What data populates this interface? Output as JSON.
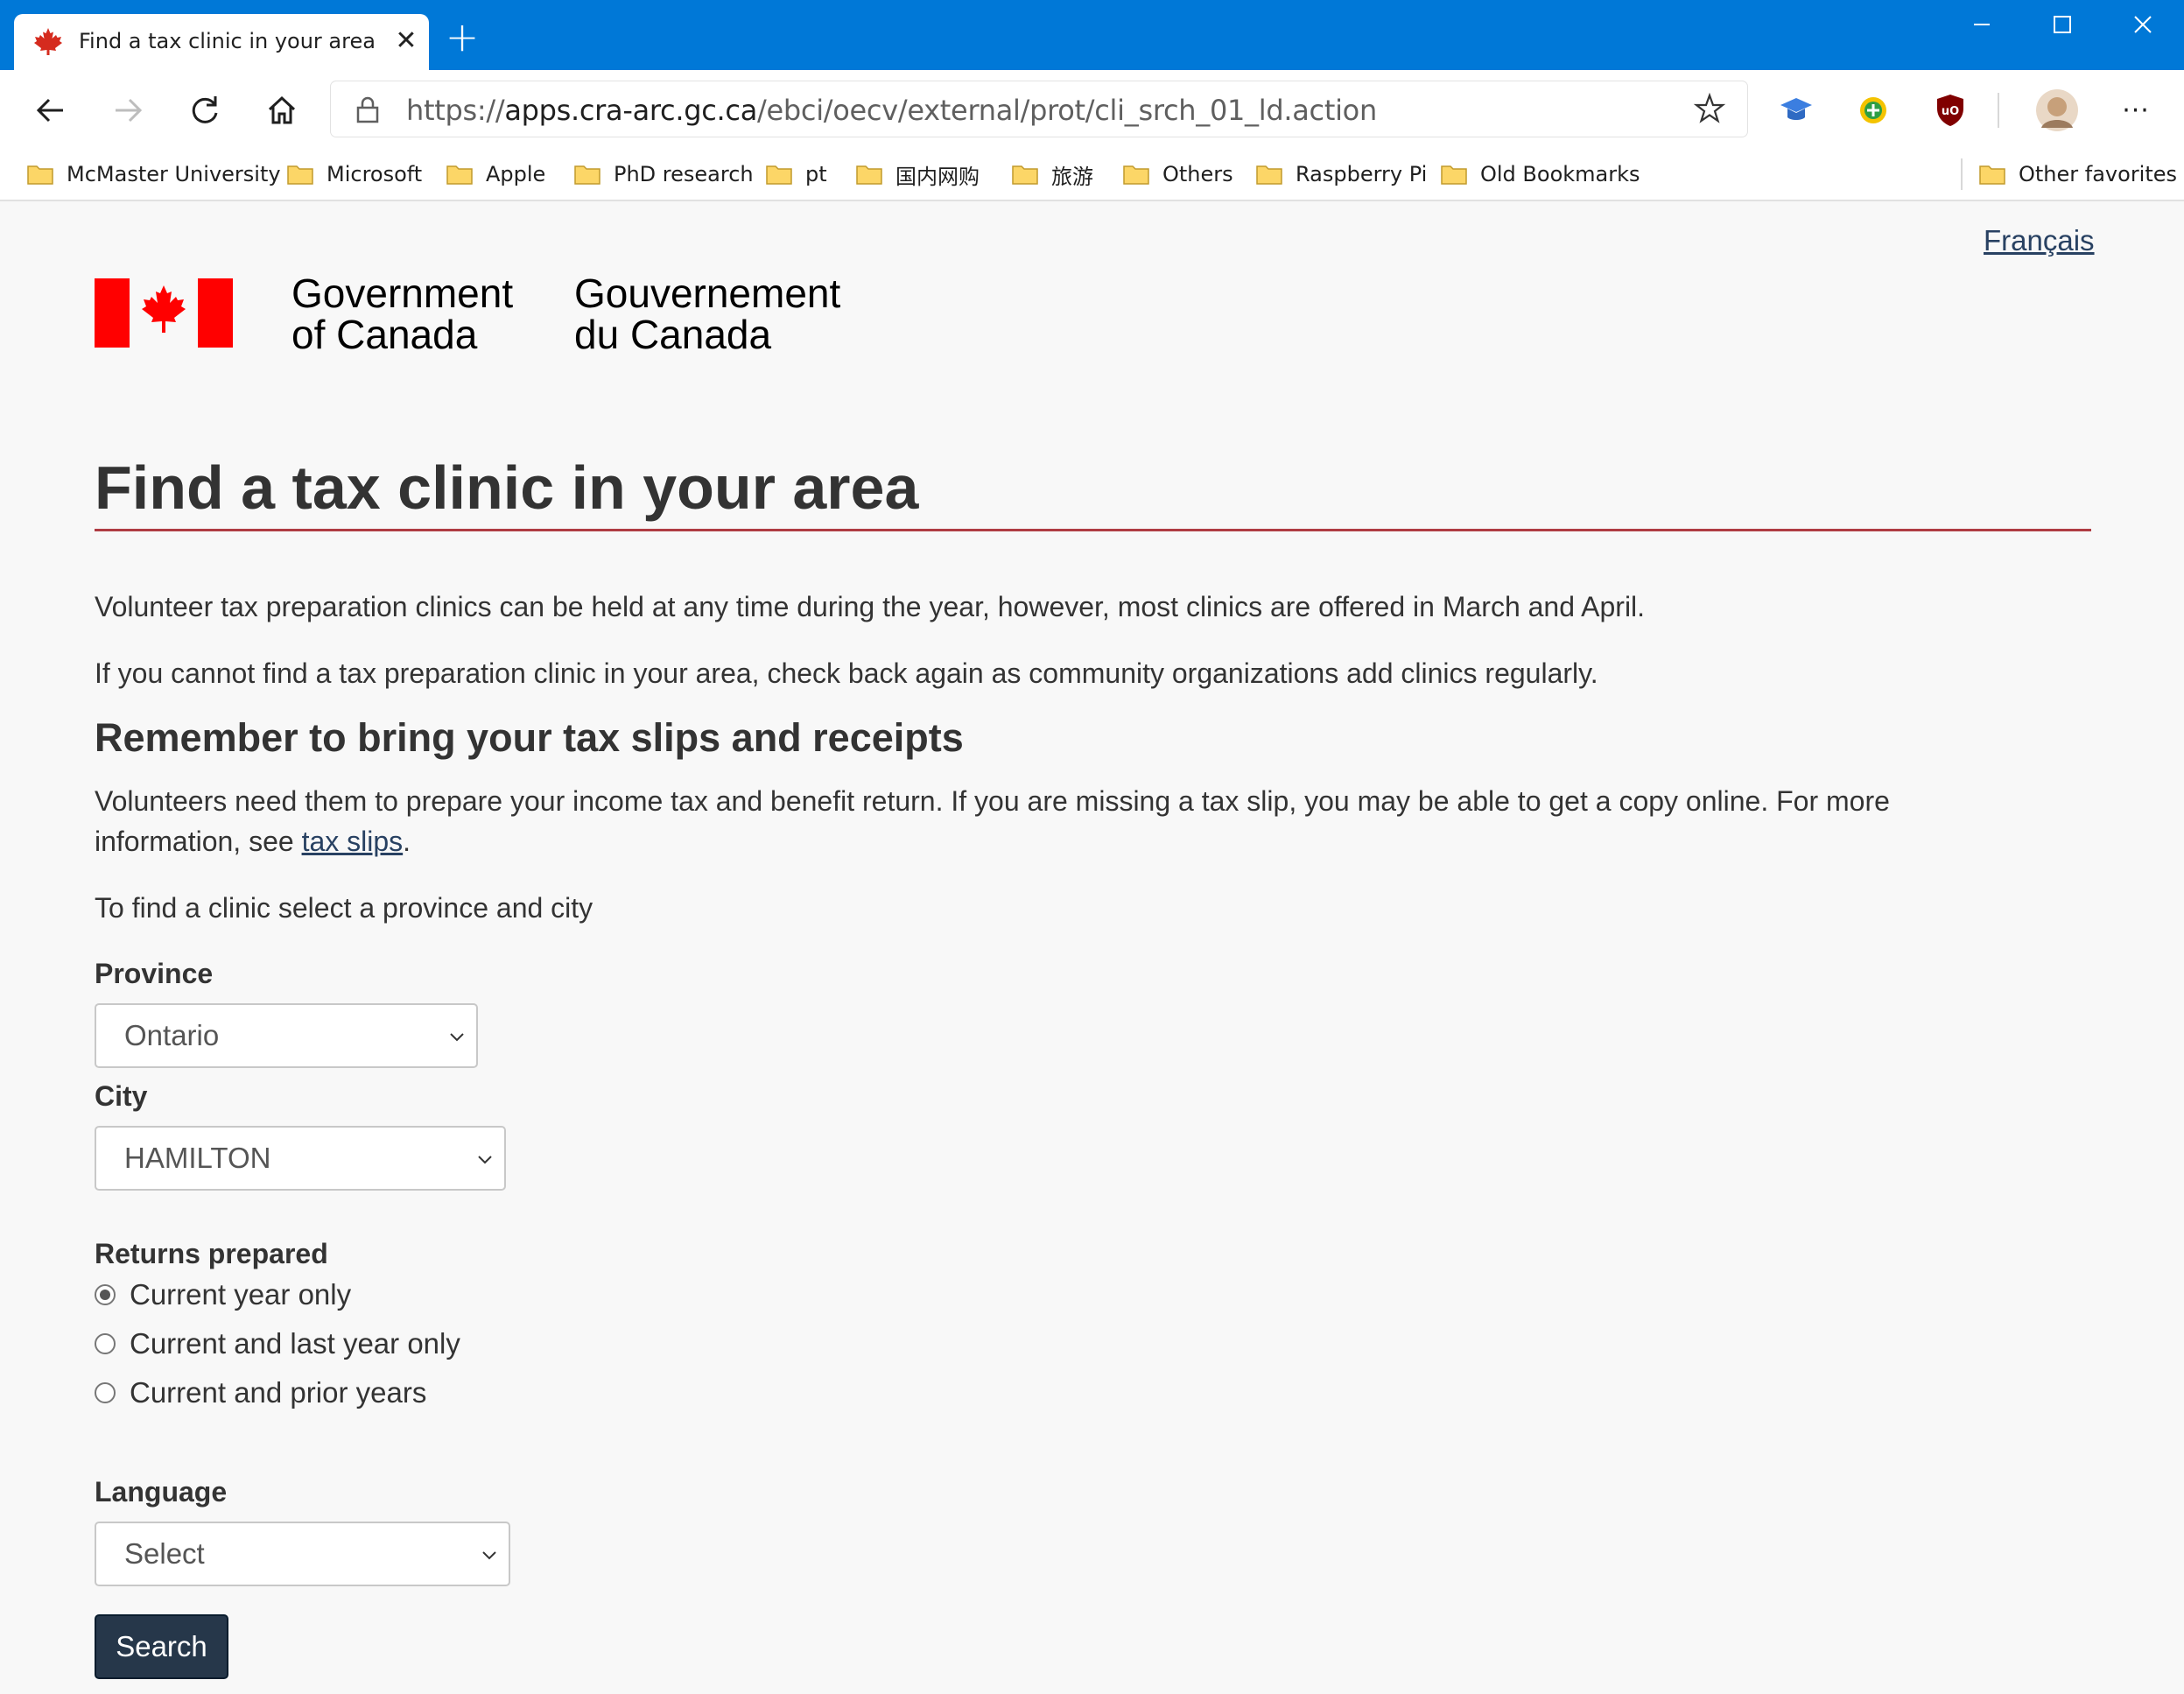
{
  "browser": {
    "tab_title": "Find a tax clinic in your area",
    "tab_close_glyph": "✕",
    "new_tab_glyph": "+",
    "window_buttons": {
      "minimize": "—",
      "maximize": "☐",
      "close": "✕"
    },
    "url_scheme": "https://",
    "url_host": "apps.cra-arc.gc.ca",
    "url_path": "/ebci/oecv/external/prot/cli_srch_01_ld.action",
    "more_glyph": "···",
    "bookmarks": [
      "McMaster University",
      "Microsoft",
      "Apple",
      "PhD research",
      "pt",
      "国内网购",
      "旅游",
      "Others",
      "Raspberry Pi",
      "Old Bookmarks"
    ],
    "other_favorites": "Other favorites",
    "icons": [
      "back-icon",
      "forward-icon",
      "refresh-icon",
      "home-icon",
      "lock-icon",
      "favorite-star-icon",
      "folder-icon"
    ],
    "colors": {
      "titlebar": "#0078d7",
      "cra_blue": "#26374a",
      "canada_red": "#ff0000",
      "rule_red": "#af3c43",
      "link": "#284162"
    }
  },
  "page": {
    "language_toggle": "Français",
    "gov_en_line1": "Government",
    "gov_en_line2": "of Canada",
    "gov_fr_line1": "Gouvernement",
    "gov_fr_line2": "du Canada",
    "title": "Find a tax clinic in your area",
    "intro_1": "Volunteer tax preparation clinics can be held at any time during the year, however, most clinics are offered in March and April.",
    "intro_2": "If you cannot find a tax preparation clinic in your area, check back again as community organizations add clinics regularly.",
    "heading_2": "Remember to bring your tax slips and receipts",
    "slips_line1": "Volunteers need them to prepare your income tax and benefit return. If you are missing a tax slip, you may be able to get a copy online. For more",
    "slips_line2_prefix": "information, see ",
    "slips_link": "tax slips",
    "slips_line2_suffix": ".",
    "instruction": "To find a clinic select a province and city",
    "province_label": "Province",
    "province_value": "Ontario",
    "city_label": "City",
    "city_value": "HAMILTON",
    "returns_label": "Returns prepared",
    "returns_options": [
      {
        "label": "Current year only",
        "selected": true
      },
      {
        "label": "Current and last year only",
        "selected": false
      },
      {
        "label": "Current and prior years",
        "selected": false
      }
    ],
    "language_label": "Language",
    "language_value": "Select",
    "search_button": "Search"
  }
}
